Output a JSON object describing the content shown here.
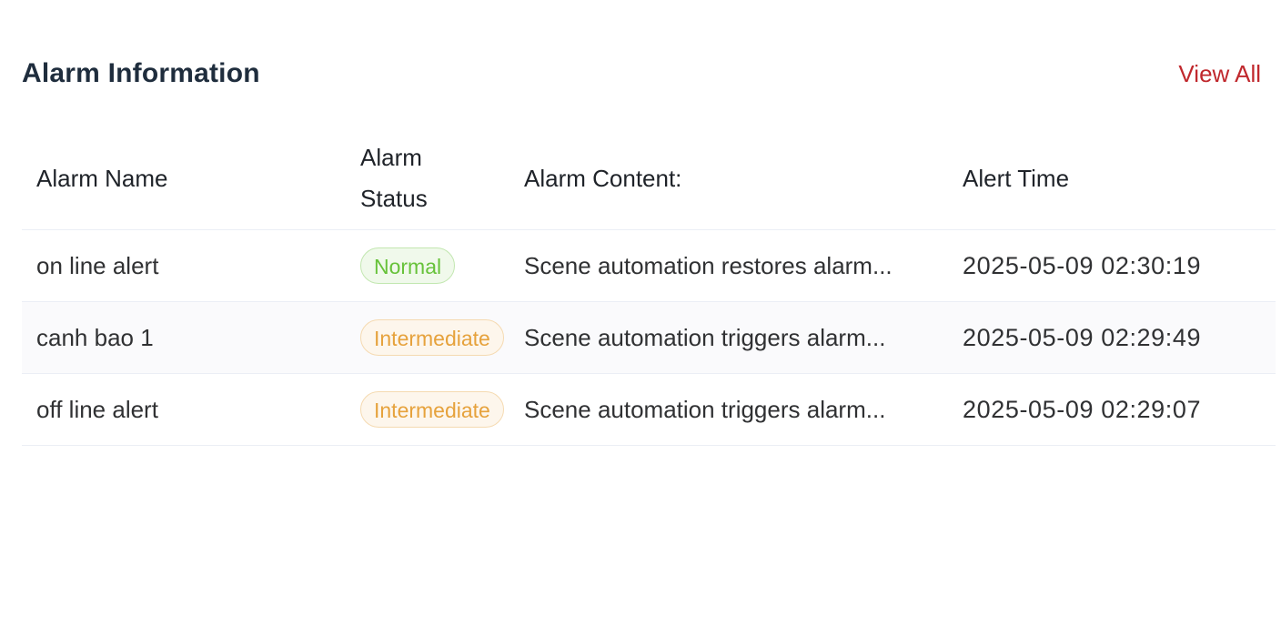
{
  "panel": {
    "title": "Alarm Information",
    "view_all_label": "View All"
  },
  "table": {
    "headers": {
      "name": "Alarm Name",
      "status_line1": "Alarm",
      "status_line2": "Status",
      "content": "Alarm Content:",
      "time": "Alert Time"
    },
    "rows": [
      {
        "name": "on line alert",
        "status": "Normal",
        "content": "Scene automation restores alarm...",
        "time": "2025-05-09 02:30:19"
      },
      {
        "name": "canh bao 1",
        "status": "Intermediate",
        "content": "Scene automation triggers alarm...",
        "time": "2025-05-09 02:29:49"
      },
      {
        "name": "off line alert",
        "status": "Intermediate",
        "content": "Scene automation triggers alarm...",
        "time": "2025-05-09 02:29:07"
      }
    ]
  },
  "colors": {
    "accent": "#c0282d",
    "status_normal": "#67c23a",
    "status_intermediate": "#e6a23c",
    "divider": "#ebeef5",
    "stripe": "#fafafc"
  }
}
